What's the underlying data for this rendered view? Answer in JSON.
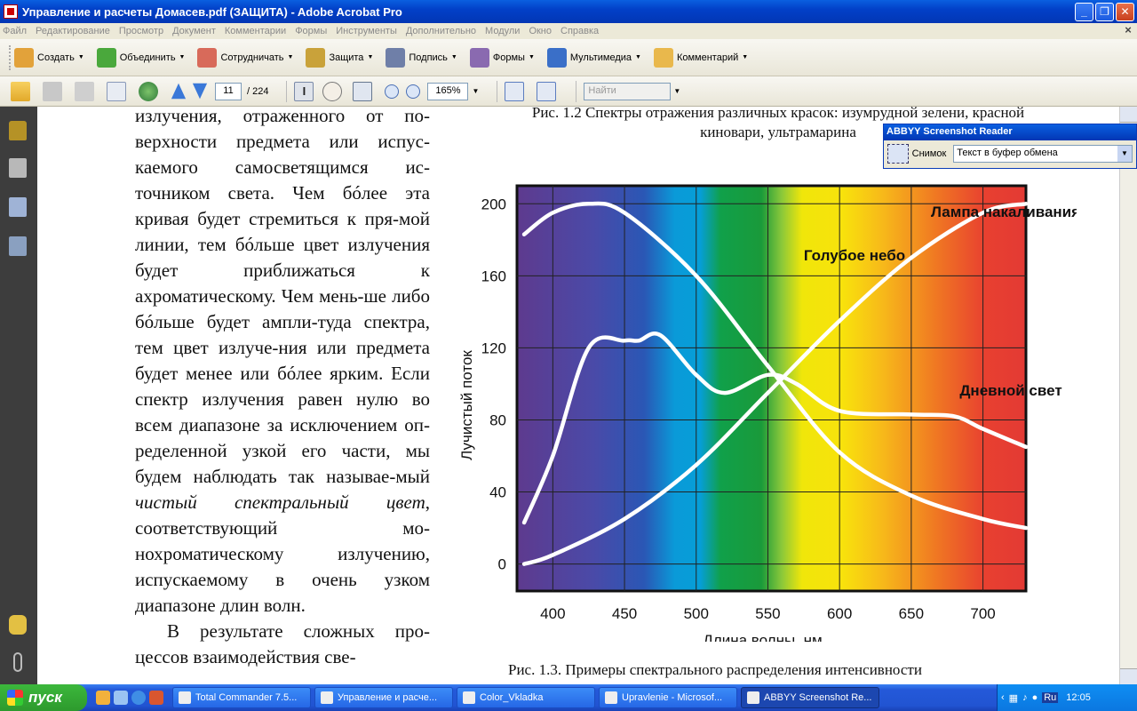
{
  "window": {
    "title": "Управление и расчеты Домасев.pdf (ЗАЩИТА) - Adobe Acrobat Pro"
  },
  "menu": [
    "Файл",
    "Редактирование",
    "Просмотр",
    "Документ",
    "Комментарии",
    "Формы",
    "Инструменты",
    "Дополнительно",
    "Модули",
    "Окно",
    "Справка"
  ],
  "toolbar1": [
    {
      "label": "Создать",
      "icon": "create-icon",
      "color": "#e2a23a"
    },
    {
      "label": "Объединить",
      "icon": "combine-icon",
      "color": "#4aa83c"
    },
    {
      "label": "Сотрудничать",
      "icon": "collaborate-icon",
      "color": "#d86a5a"
    },
    {
      "label": "Защита",
      "icon": "lock-icon",
      "color": "#c9a23a"
    },
    {
      "label": "Подпись",
      "icon": "pen-icon",
      "color": "#6f7fa8"
    },
    {
      "label": "Формы",
      "icon": "forms-icon",
      "color": "#8a6ab0"
    },
    {
      "label": "Мультимедиа",
      "icon": "multimedia-icon",
      "color": "#3a6fc8"
    },
    {
      "label": "Комментарий",
      "icon": "comment-icon",
      "color": "#e9b84c"
    }
  ],
  "toolbar2": {
    "page_current": "11",
    "page_total": "/ 224",
    "zoom": "165%",
    "search_placeholder": "Найти"
  },
  "document": {
    "body_html_parts": [
      {
        "t": "излучения, отраженного от по-верхности предмета или испус-каемого самосветящимся ис-точником света. Чем бóлее эта кривая будет стремиться к пря-мой линии, тем бóльше цвет излучения будет приближаться к ахроматическому. Чем мень-ше либо бóльше будет ампли-туда спектра, тем цвет излуче-ния или предмета будет менее или бóлее ярким. Если спектр излучения равен нулю во всем диапазоне за исключением оп-ределенной узкой его части, мы будем наблюдать так называе-мый "
      },
      {
        "t": "чистый спектральный цвет",
        "italic": true
      },
      {
        "t": ", соответствующий мо-нохроматическому излучению, испускаемому в очень узком диапазоне длин волн."
      }
    ],
    "para2": "В результате сложных про-цессов взаимодействия све-",
    "caption_top": "Рис. 1.2 Спектры отражения различных красок: изумрудной зелени, красной киновари, ультрамарина",
    "caption_bottom": "Рис. 1.3. Примеры спектрального распределения интенсивности"
  },
  "chart_data": {
    "type": "line",
    "xlabel": "Длина волны, нм",
    "ylabel": "Лучистый поток",
    "xlim": [
      375,
      730
    ],
    "ylim": [
      -15,
      210
    ],
    "xticks": [
      400,
      450,
      500,
      550,
      600,
      650,
      700
    ],
    "yticks": [
      0,
      40,
      80,
      120,
      160,
      200
    ],
    "series": [
      {
        "name": "Лампа накаливания",
        "x": [
          380,
          400,
          450,
          500,
          550,
          600,
          650,
          700,
          730
        ],
        "y": [
          0,
          5,
          25,
          55,
          95,
          135,
          170,
          195,
          200
        ]
      },
      {
        "name": "Голубое небо",
        "x": [
          380,
          400,
          425,
          450,
          500,
          550,
          600,
          650,
          700,
          730
        ],
        "y": [
          183,
          195,
          200,
          195,
          160,
          110,
          62,
          38,
          25,
          20
        ]
      },
      {
        "name": "Дневной свет",
        "x": [
          380,
          400,
          425,
          450,
          460,
          475,
          500,
          520,
          550,
          570,
          600,
          650,
          680,
          700,
          730
        ],
        "y": [
          23,
          60,
          120,
          124,
          124,
          127,
          105,
          95,
          105,
          100,
          85,
          83,
          82,
          75,
          65
        ]
      }
    ],
    "grid": true
  },
  "abbyy": {
    "title": "ABBYY Screenshot Reader",
    "snap_label": "Снимок",
    "mode": "Текст в буфер обмена"
  },
  "taskbar": {
    "start": "пуск",
    "tasks": [
      "Total Commander 7.5...",
      "Управление и расче...",
      "Color_Vkladka",
      "Upravlenie - Microsof...",
      "ABBYY Screenshot Re..."
    ],
    "lang": "Ru",
    "clock": "12:05"
  }
}
